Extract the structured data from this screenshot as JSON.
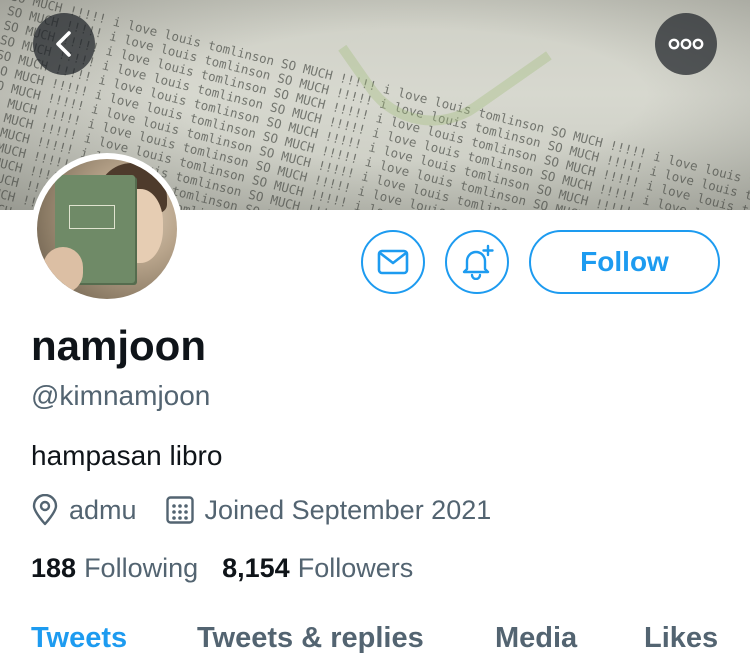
{
  "banner": {
    "lines": [
      "tomlinson SO MUCH !!!!! i love louis tomlinson SO MUCH !!!!! i love louis tomlinson SO MUCH !!!!! i love louis tomlinson SO MUCH",
      "tomlinson SO MUCH !!!!! i love louis tomlinson SO MUCH !!!!! i love louis tomlinson SO MUCH !!!!! i love louis tomlinson SO MUCH",
      "tomlinson SO MUCH !!!!! i love louis tomlinson SO MUCH !!!!! i love louis tomlinson SO MUCH !!!!! i love louis tomlinson SO MUCH",
      "tomlinson SO MUCH !!!!! i love louis tomlinson SO MUCH !!!!! i love louis tomlinson SO MUCH !!!!! i love louis tomlinson SO MUCH",
      "tomlinson SO MUCH !!!!! i love louis tomlinson SO MUCH !!!!! i love louis tomlinson SO MUCH !!!!! i love louis tomlinson SO MUCH",
      "tomlinson SO MUCH !!!!! i love louis tomlinson SO MUCH !!!!! i love louis tomlinson SO MUCH !!!!! i love louis tomlinson SO MUCH",
      "tomlinson SO MUCH !!!!! i love louis tomlinson SO MUCH !!!!! i love louis tomlinson SO MUCH !!!!! i love louis tomlinson SO MUCH",
      "tomlinson SO MUCH !!!!! i love louis tomlinson SO MUCH !!!!! i love louis tomlinson SO MUCH !!!!! i love louis tomlinson SO MUCH",
      "tomlinson SO MUCH !!!!! i love louis tomlinson SO MUCH !!!!! i love louis tomlinson SO MUCH !!!!! i love louis tomlinson SO MUCH",
      "tomlinson SO MUCH !!!!! i love louis tomlinson SO MUCH !!!!! i love louis tomlinson SO MUCH !!!!! i love louis tomlinson SO MUCH",
      "tomlinson SO MUCH !!!!! i love louis tomlinson SO MUCH !!!!! i love louis tomlinson SO MUCH !!!!! i love louis tomlinson SO MUCH",
      "tomlinson SO MUCH !!!!! i love louis tomlinson SO MUCH !!!!! i love louis tomlinson SO MUCH !!!!! i love louis tomlinson SO MUCH",
      "tomlinson SO MUCH !!!!! i love louis tomlinson SO MUCH !!!!! i love louis tomlinson SO MUCH !!!!! i love louis tomlinson SO MUCH",
      "tomlinson SO MUCH !!!!! i love louis tomlinson SO MUCH !!!!! i love louis tomlinson SO MUCH !!!!! i love louis tomlinson SO MUCH",
      "tomlinson SO MUCH !!!!! i love louis tomlinson SO MUCH !!!!! i love louis tomlinson SO MUCH !!!!! i love louis tomlinson SO MUCH",
      "tomlinson SO MUCH !!!!! i love louis tomlinson SO MUCH !!!!! i love louis tomlinson SO MUCH !!!!! i love louis tomlinson SO MUCH"
    ]
  },
  "nav": {
    "back_icon": "chevron-left-icon",
    "more_icon": "ellipsis-icon"
  },
  "actions": {
    "message_icon": "envelope-icon",
    "notify_icon": "bell-plus-icon",
    "follow_label": "Follow"
  },
  "profile": {
    "display_name": "namjoon",
    "handle": "@kimnamjoon",
    "bio": "hampasan libro",
    "location": "admu",
    "joined": "Joined September 2021",
    "following_count": "188",
    "following_label": "Following",
    "followers_count": "8,154",
    "followers_label": "Followers"
  },
  "tabs": {
    "tweets": "Tweets",
    "replies": "Tweets & replies",
    "media": "Media",
    "likes": "Likes",
    "active": "tweets"
  },
  "colors": {
    "accent": "#1d9bf0",
    "text_primary": "#0f1419",
    "text_secondary": "#536471"
  }
}
